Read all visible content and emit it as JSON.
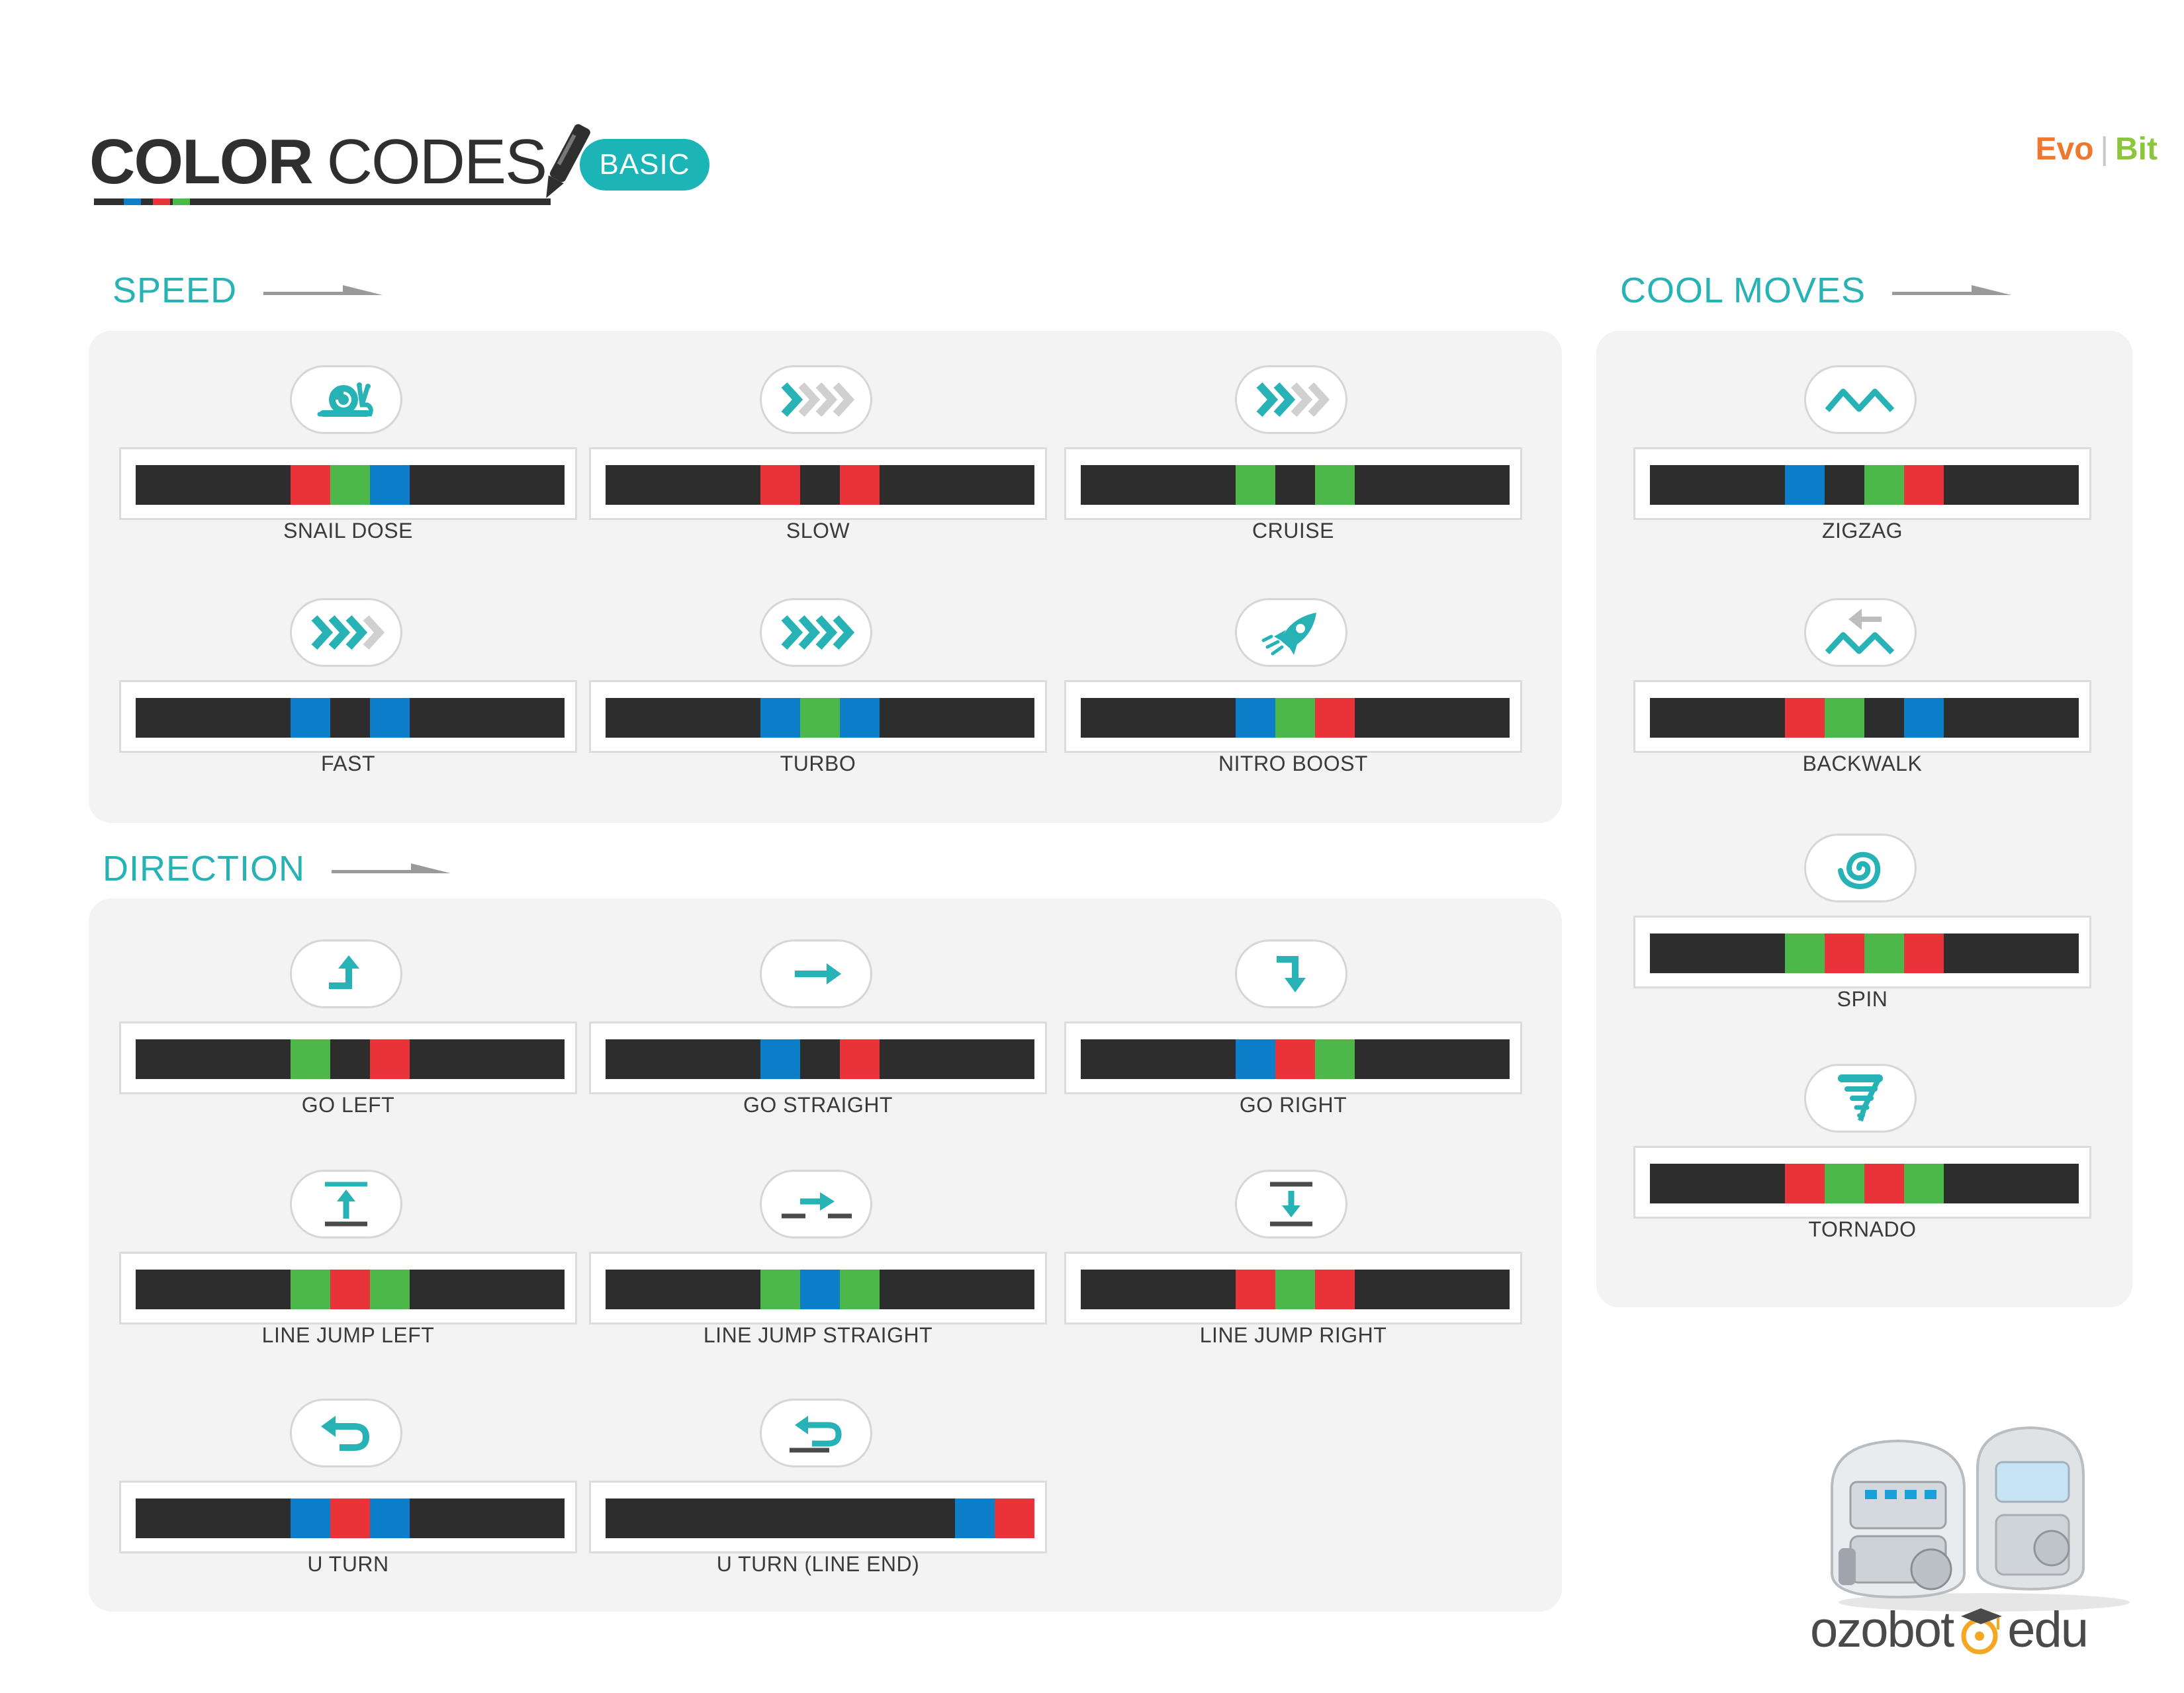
{
  "header": {
    "title_bold": "COLOR",
    "title_light": "CODES",
    "badge": "BASIC",
    "brand_evo": "Evo",
    "brand_sep": "|",
    "brand_bit": "Bit"
  },
  "colors": {
    "K": "#2e2d2d",
    "R": "#ea3339",
    "G": "#4cb84a",
    "B": "#0d7ec9",
    "accent": "#27b2b6",
    "badge": "#1bb5b8"
  },
  "sections": {
    "speed": {
      "title": "SPEED",
      "items": [
        {
          "label": "SNAIL DOSE",
          "icon": "snail-icon",
          "code": [
            "R",
            "G",
            "B"
          ]
        },
        {
          "label": "SLOW",
          "icon": "chevrons-1-icon",
          "code": [
            "R",
            "K",
            "R"
          ]
        },
        {
          "label": "CRUISE",
          "icon": "chevrons-2-icon",
          "code": [
            "G",
            "K",
            "G"
          ]
        },
        {
          "label": "FAST",
          "icon": "chevrons-3-icon",
          "code": [
            "B",
            "K",
            "B"
          ]
        },
        {
          "label": "TURBO",
          "icon": "chevrons-4-icon",
          "code": [
            "B",
            "G",
            "B"
          ]
        },
        {
          "label": "NITRO BOOST",
          "icon": "rocket-icon",
          "code": [
            "B",
            "G",
            "R"
          ]
        }
      ]
    },
    "direction": {
      "title": "DIRECTION",
      "items": [
        {
          "label": "GO LEFT",
          "icon": "turn-left-icon",
          "code": [
            "G",
            "K",
            "R"
          ]
        },
        {
          "label": "GO STRAIGHT",
          "icon": "arrow-right-icon",
          "code": [
            "B",
            "K",
            "R"
          ]
        },
        {
          "label": "GO RIGHT",
          "icon": "turn-right-icon",
          "code": [
            "B",
            "R",
            "G"
          ]
        },
        {
          "label": "LINE JUMP LEFT",
          "icon": "line-jump-left-icon",
          "code": [
            "G",
            "R",
            "G"
          ]
        },
        {
          "label": "LINE JUMP STRAIGHT",
          "icon": "line-jump-straight-icon",
          "code": [
            "G",
            "B",
            "G"
          ]
        },
        {
          "label": "LINE JUMP RIGHT",
          "icon": "line-jump-right-icon",
          "code": [
            "R",
            "G",
            "R"
          ]
        },
        {
          "label": "U TURN",
          "icon": "u-turn-icon",
          "code": [
            "B",
            "R",
            "B"
          ]
        },
        {
          "label": "U TURN (LINE END)",
          "icon": "u-turn-line-end-icon",
          "code": [
            "B",
            "R"
          ]
        }
      ]
    },
    "cool_moves": {
      "title": "COOL MOVES",
      "items": [
        {
          "label": "ZIGZAG",
          "icon": "zigzag-icon",
          "code": [
            "B",
            "K",
            "G",
            "R"
          ]
        },
        {
          "label": "BACKWALK",
          "icon": "backwalk-icon",
          "code": [
            "R",
            "G",
            "K",
            "B"
          ]
        },
        {
          "label": "SPIN",
          "icon": "spin-icon",
          "code": [
            "G",
            "R",
            "G",
            "R"
          ]
        },
        {
          "label": "TORNADO",
          "icon": "tornado-icon",
          "code": [
            "R",
            "G",
            "R",
            "G"
          ]
        }
      ]
    }
  },
  "footer": {
    "logo_text": "ozobot",
    "logo_edu": "edu"
  }
}
